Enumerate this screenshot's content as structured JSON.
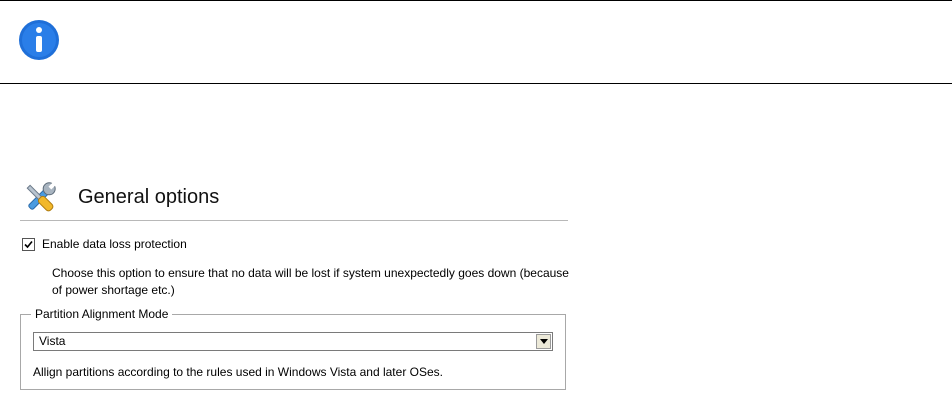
{
  "info_banner": {
    "icon": "info-icon",
    "icon_color": "#1f6fd8"
  },
  "general_options": {
    "icon": "tools-icon",
    "title": "General options",
    "data_loss": {
      "label": "Enable data loss protection",
      "checked": true,
      "description": "Choose this option to ensure that no data will be lost if system unexpectedly goes down (because of power shortage etc.)"
    },
    "alignment": {
      "legend": "Partition Alignment Mode",
      "selected": "Vista",
      "description": "Allign partitions according to the rules used in Windows Vista and later OSes."
    }
  }
}
